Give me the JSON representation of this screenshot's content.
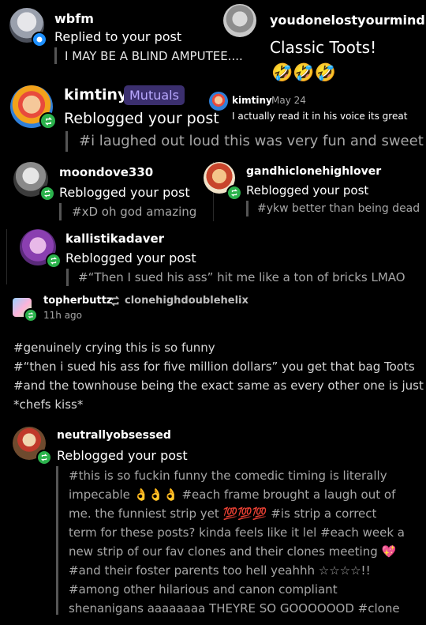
{
  "n1": {
    "username": "wbfm",
    "action": "Replied to your post",
    "quote": "I MAY BE A BLIND AMPUTEE...."
  },
  "n2": {
    "username": "youdonelostyourmind",
    "text": "Classic Toots!",
    "emoji": "🤣🤣🤣"
  },
  "n3": {
    "username": "kimtiny",
    "badge": "Mutuals",
    "action": "Reblogged your post",
    "quote": "#i laughed out loud this was very fun and sweet"
  },
  "n3_inline": {
    "username": "kimtiny",
    "date": "May 24",
    "text": "I actually read it in his voice its great"
  },
  "n4": {
    "username": "moondove330",
    "action": "Reblogged your post",
    "quote": "#xD oh god amazing"
  },
  "n5": {
    "username": "gandhiclonehighlover",
    "action": "Reblogged your post",
    "quote": "#ykw better than being dead"
  },
  "n6": {
    "username": "kallistikadaver",
    "action": "Reblogged your post",
    "quote": "#“Then I sued his ass” hit me like a ton of bricks LMAO"
  },
  "post": {
    "username": "topherbuttz",
    "reblog_from": "clonehighdoublehelix",
    "time": "11h ago",
    "tags": [
      "#genuinely crying this is so funny",
      "#“then i sued his ass for five million dollars” you get that bag Toots",
      "#and the townhouse being the exact same as every other one is just",
      "*chefs kiss*"
    ]
  },
  "n7": {
    "username": "neutrallyobsessed",
    "action": "Reblogged your post",
    "lines": [
      "#this is so fuckin funny the comedic timing is literally",
      "impecable 👌👌👌 #each frame brought a laugh out of",
      "me. the funniest strip yet 💯💯💯 #is strip a correct",
      "term for these posts? kinda feels like it lel #each week a",
      "new strip of our fav clones and their clones meeting 💖",
      "#and their foster parents too hell yeahhh ☆☆☆☆!!",
      "#among other hilarious and canon compliant",
      "shenanigans aaaaaaaa THEYRE SO GOOOOOOD #clone"
    ]
  },
  "colors": {
    "background": "#000000",
    "reblog_badge": "#2bb24c",
    "reply_badge": "#1e90ff",
    "mutuals_bg": "#3b2f6e",
    "mutuals_text": "#b9a8ff"
  }
}
